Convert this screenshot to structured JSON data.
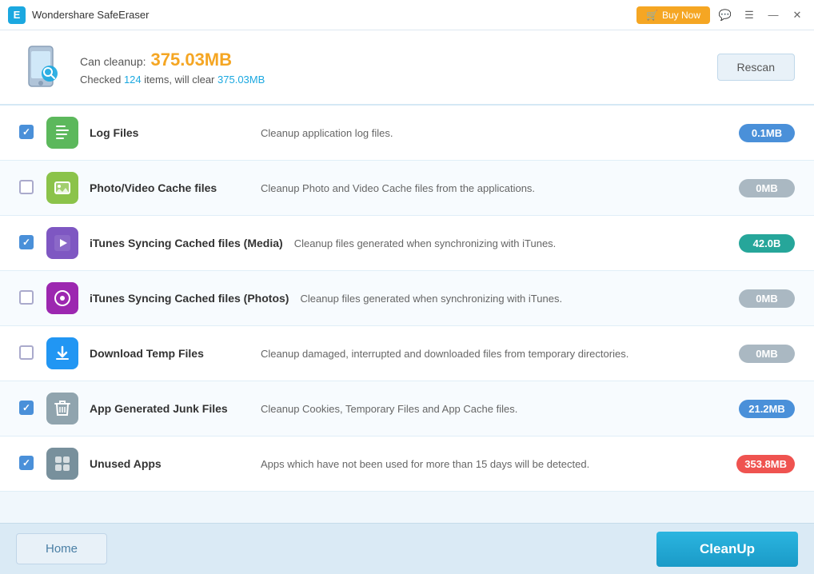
{
  "titleBar": {
    "logoText": "E",
    "title": "Wondershare SafeEraser",
    "buyNowLabel": "Buy Now",
    "chatIcon": "💬",
    "menuIcon": "☰",
    "minimizeIcon": "—",
    "closeIcon": "✕"
  },
  "header": {
    "canCleanupLabel": "Can cleanup:",
    "cleanupSize": "375.03MB",
    "checkedPrefix": "Checked",
    "checkedCount": "124",
    "checkedMiddle": "items, will clear",
    "checkedSize": "375.03MB",
    "rescanLabel": "Rescan"
  },
  "items": [
    {
      "id": "log-files",
      "checked": true,
      "iconClass": "icon-green",
      "iconSymbol": "≡",
      "name": "Log Files",
      "description": "Cleanup application log files.",
      "size": "0.1MB",
      "sizeClass": "size-blue"
    },
    {
      "id": "photo-video-cache",
      "checked": false,
      "iconClass": "icon-lime",
      "iconSymbol": "🖼",
      "name": "Photo/Video Cache files",
      "description": "Cleanup Photo and Video Cache files from the applications.",
      "size": "0MB",
      "sizeClass": "size-gray"
    },
    {
      "id": "itunes-media",
      "checked": true,
      "iconClass": "icon-purple",
      "iconSymbol": "▶",
      "name": "iTunes Syncing Cached files (Media)",
      "description": "Cleanup files generated when synchronizing with iTunes.",
      "size": "42.0B",
      "sizeClass": "size-teal"
    },
    {
      "id": "itunes-photos",
      "checked": false,
      "iconClass": "icon-purple2",
      "iconSymbol": "📷",
      "name": "iTunes Syncing Cached files (Photos)",
      "description": "Cleanup files generated when synchronizing with iTunes.",
      "size": "0MB",
      "sizeClass": "size-gray"
    },
    {
      "id": "download-temp",
      "checked": false,
      "iconClass": "icon-blue",
      "iconSymbol": "⬇",
      "name": "Download Temp Files",
      "description": "Cleanup damaged, interrupted and downloaded files from temporary directories.",
      "size": "0MB",
      "sizeClass": "size-gray"
    },
    {
      "id": "app-junk",
      "checked": true,
      "iconClass": "icon-gray",
      "iconSymbol": "🗑",
      "name": "App Generated Junk Files",
      "description": "Cleanup Cookies, Temporary Files and App Cache files.",
      "size": "21.2MB",
      "sizeClass": "size-blue"
    },
    {
      "id": "unused-apps",
      "checked": true,
      "iconClass": "icon-gray2",
      "iconSymbol": "🎮",
      "name": "Unused Apps",
      "description": "Apps which have not been used for more than 15 days will be detected.",
      "size": "353.8MB",
      "sizeClass": "size-orange"
    }
  ],
  "footer": {
    "homeLabel": "Home",
    "cleanupLabel": "CleanUp"
  }
}
